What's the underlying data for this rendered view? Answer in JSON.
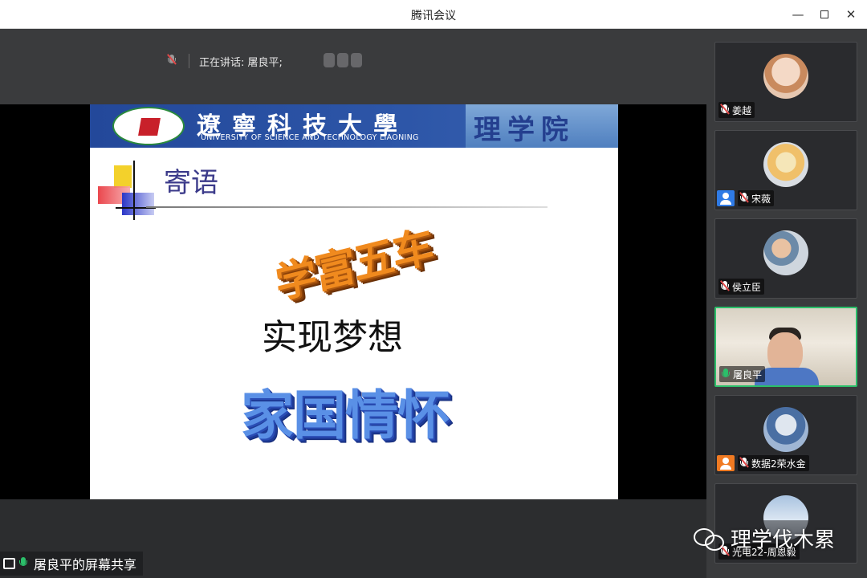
{
  "window": {
    "title": "腾讯会议"
  },
  "main": {
    "speaking_label": "正在讲话: 屠良平;",
    "share_label": "屠良平的屏幕共享"
  },
  "slide": {
    "banner_cn": "遼寧科技大學",
    "banner_en": "UNIVERSITY OF SCIENCE AND TECHNOLOGY LIAONING",
    "banner_school": "理学院",
    "heading": "寄语",
    "line1": "学富五车",
    "line2": "实现梦想",
    "line3": "家国情怀"
  },
  "participants": [
    {
      "name": "姜越",
      "mic": "muted"
    },
    {
      "name": "宋薇",
      "mic": "muted"
    },
    {
      "name": "侯立臣",
      "mic": "muted"
    },
    {
      "name": "屠良平",
      "mic": "active"
    },
    {
      "name": "数据2荣水金",
      "mic": "muted"
    },
    {
      "name": "光电22-周恩毅",
      "mic": "muted"
    }
  ],
  "watermark": {
    "text": "理学伐木累"
  },
  "colors": {
    "accent_green": "#2bbf6a",
    "muted_red": "#e04848",
    "user_blue": "#2f7be6",
    "user_orange": "#f07a22"
  }
}
